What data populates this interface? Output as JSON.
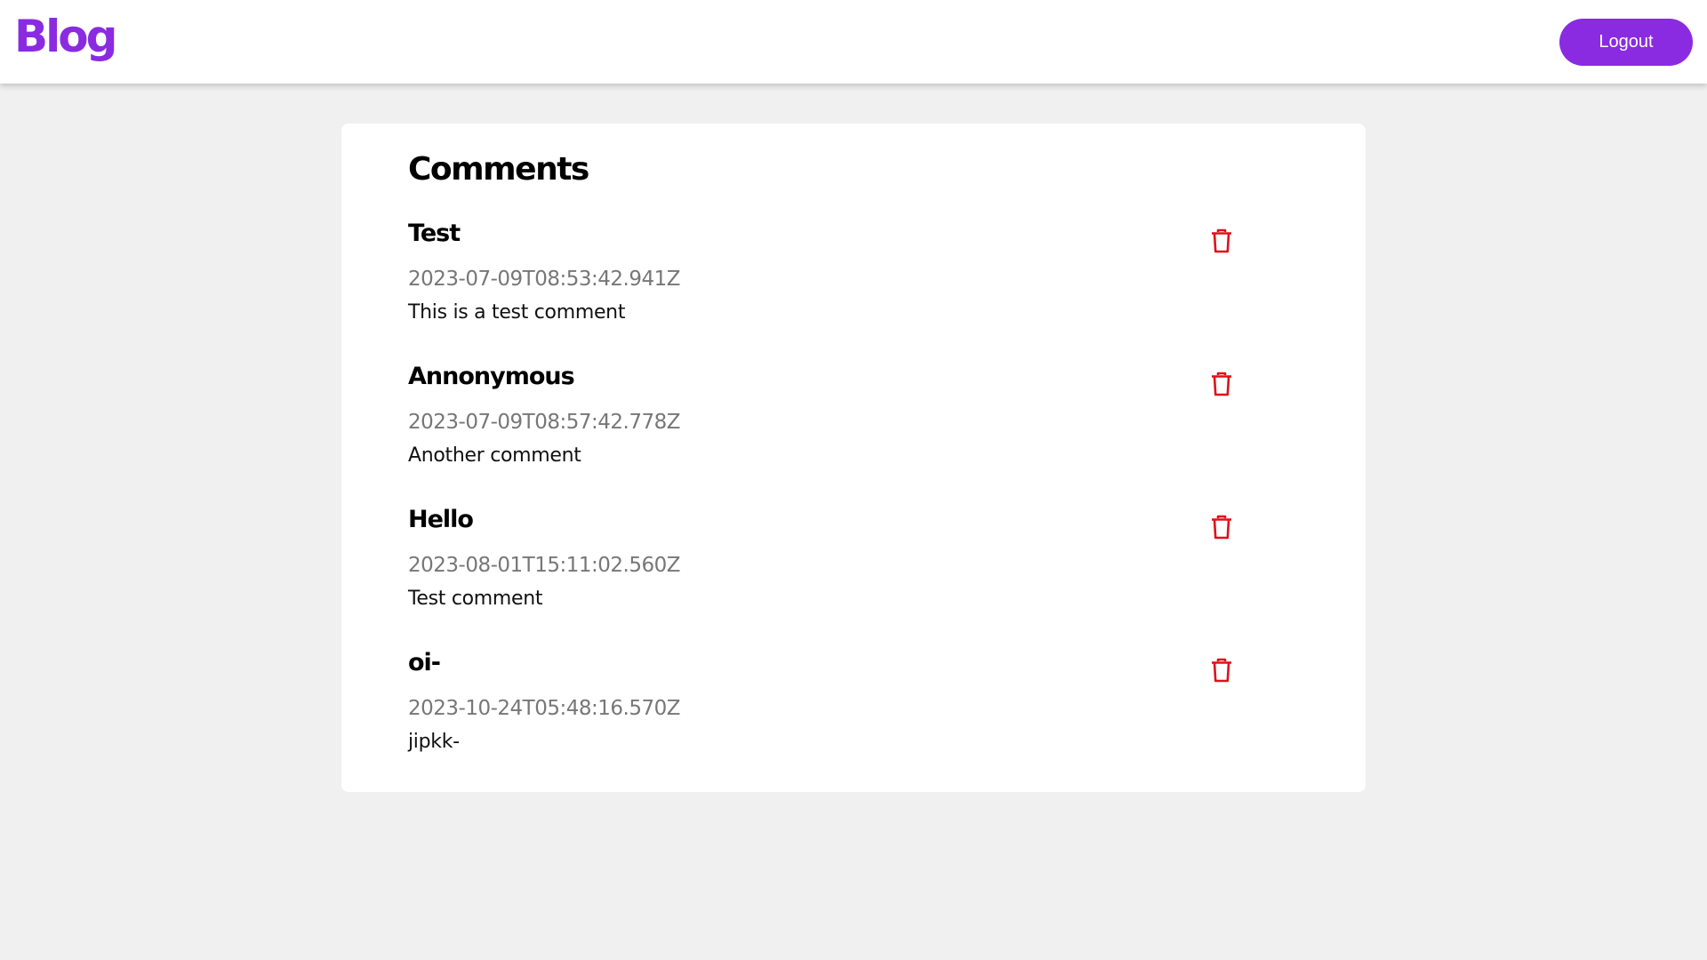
{
  "header": {
    "logo_text": "Blog",
    "logout_label": "Logout"
  },
  "colors": {
    "accent": "#8a2be2",
    "delete": "#e0101a",
    "background": "#f0f0f0"
  },
  "main": {
    "title": "Comments",
    "comments": [
      {
        "author": "Test",
        "date": "2023-07-09T08:53:42.941Z",
        "text": "This is a test comment",
        "icon": "trash-icon"
      },
      {
        "author": "Annonymous",
        "date": "2023-07-09T08:57:42.778Z",
        "text": "Another comment",
        "icon": "trash-icon"
      },
      {
        "author": "Hello",
        "date": "2023-08-01T15:11:02.560Z",
        "text": "Test comment",
        "icon": "trash-icon"
      },
      {
        "author": "oi-",
        "date": "2023-10-24T05:48:16.570Z",
        "text": "jipkk-",
        "icon": "trash-icon"
      }
    ]
  }
}
